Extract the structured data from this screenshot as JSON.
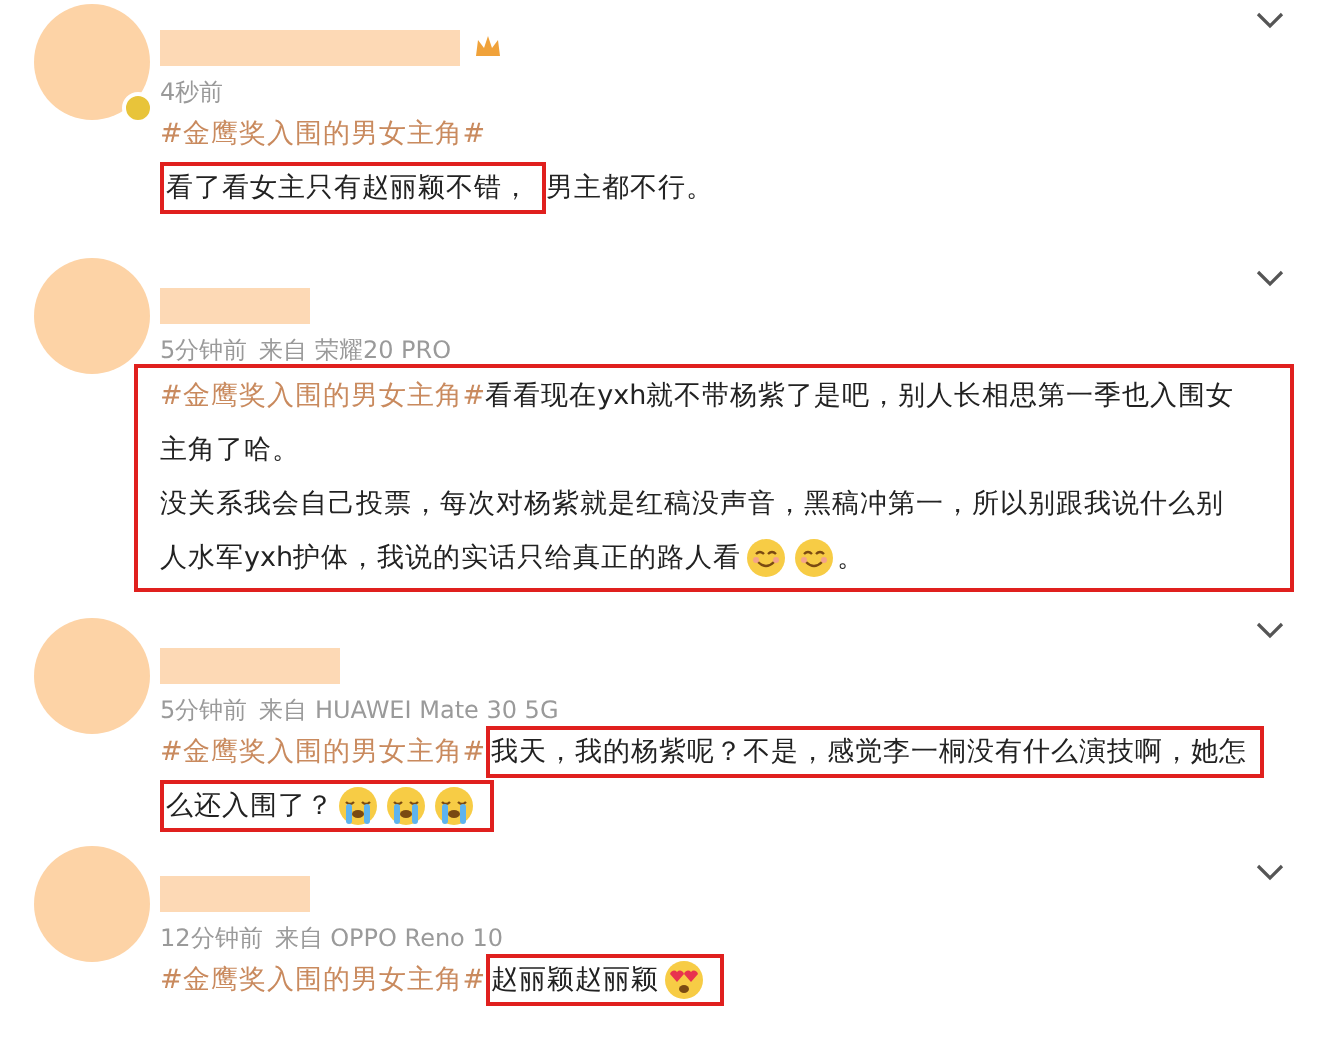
{
  "comments": [
    {
      "badge": true,
      "time": "4秒前",
      "boxed": false,
      "lines": [
        [
          {
            "kind": "hashtag",
            "text": "#金鹰奖入围的男女主角#"
          }
        ],
        [
          {
            "kind": "highlight",
            "items": [
              {
                "kind": "text",
                "text": "看了看女主只有赵丽颖不错，"
              }
            ]
          },
          {
            "kind": "text",
            "text": "男主都不行。"
          }
        ]
      ]
    },
    {
      "badge": false,
      "time": "5分钟前",
      "source": "来自 荣耀20 PRO",
      "boxed": true,
      "lines": [
        [
          {
            "kind": "hashtag",
            "text": "#金鹰奖入围的男女主角#"
          },
          {
            "kind": "text",
            "text": "看看现在yxh就不带杨紫了是吧，别人长相思第一季也入围女"
          }
        ],
        [
          {
            "kind": "text",
            "text": "主角了哈。"
          }
        ],
        [
          {
            "kind": "text",
            "text": "没关系我会自己投票，每次对杨紫就是红稿没声音，黑稿冲第一，所以别跟我说什么别"
          }
        ],
        [
          {
            "kind": "text",
            "text": "人水军yxh护体，我说的实话只给真正的路人看"
          },
          {
            "kind": "smile"
          },
          {
            "kind": "smile"
          },
          {
            "kind": "text",
            "text": "。"
          }
        ]
      ]
    },
    {
      "badge": false,
      "time": "5分钟前",
      "source": "来自 HUAWEI Mate 30 5G",
      "boxed": false,
      "lines": [
        [
          {
            "kind": "hashtag",
            "text": "#金鹰奖入围的男女主角#"
          },
          {
            "kind": "highlight",
            "items": [
              {
                "kind": "text",
                "text": "我天，我的杨紫呢？不是，感觉李一桐没有什么演技啊，她怎"
              }
            ]
          }
        ],
        [
          {
            "kind": "highlight",
            "items": [
              {
                "kind": "text",
                "text": "么还入围了？"
              },
              {
                "kind": "cry"
              },
              {
                "kind": "cry"
              },
              {
                "kind": "cry"
              }
            ]
          }
        ]
      ]
    },
    {
      "badge": false,
      "time": "12分钟前",
      "source": "来自 OPPO Reno 10",
      "boxed": false,
      "lines": [
        [
          {
            "kind": "hashtag",
            "text": "#金鹰奖入围的男女主角#"
          },
          {
            "kind": "highlight",
            "items": [
              {
                "kind": "text",
                "text": "赵丽颖赵丽颖"
              },
              {
                "kind": "hearteyes"
              }
            ]
          }
        ]
      ]
    }
  ]
}
